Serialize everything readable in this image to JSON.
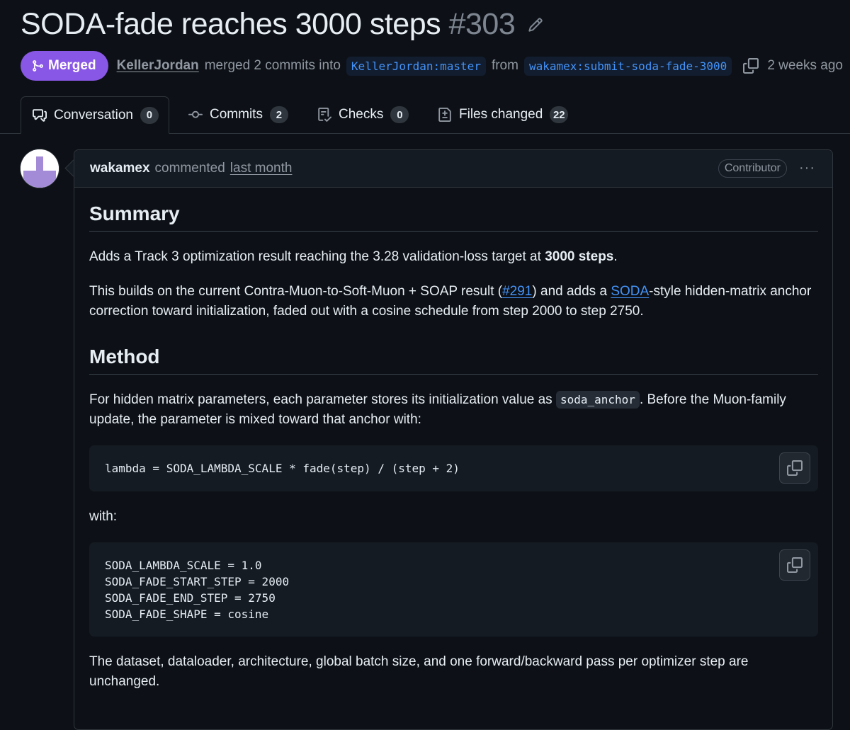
{
  "pr": {
    "title": "SODA-fade reaches 3000 steps",
    "number": "#303",
    "state": "Merged",
    "author": "KellerJordan",
    "merge_text": "merged 2 commits into",
    "base_branch": "KellerJordan:master",
    "from_text": "from",
    "head_branch": "wakamex:submit-soda-fade-3000",
    "time_ago": "2 weeks ago"
  },
  "tabs": [
    {
      "label": "Conversation",
      "count": "0",
      "icon": "comment-discussion-icon"
    },
    {
      "label": "Commits",
      "count": "2",
      "icon": "git-commit-icon"
    },
    {
      "label": "Checks",
      "count": "0",
      "icon": "checklist-icon"
    },
    {
      "label": "Files changed",
      "count": "22",
      "icon": "file-diff-icon"
    }
  ],
  "comment": {
    "user": "wakamex",
    "action": "commented",
    "time": "last month",
    "role": "Contributor",
    "menu": "···"
  },
  "content": {
    "summary_heading": "Summary",
    "p1_pre": "Adds a Track 3 optimization result reaching the 3.28 validation-loss target at ",
    "p1_bold": "3000 steps",
    "p1_post": ".",
    "p2_a": "This builds on the current Contra-Muon-to-Soft-Muon + SOAP result (",
    "p2_link1": "#291",
    "p2_b": ") and adds a ",
    "p2_link2": "SODA",
    "p2_c": "-style hidden-matrix anchor correction toward initialization, faded out with a cosine schedule from step 2000 to step 2750.",
    "method_heading": "Method",
    "p3_a": "For hidden matrix parameters, each parameter stores its initialization value as ",
    "p3_code": "soda_anchor",
    "p3_b": ". Before the Muon-family update, the parameter is mixed toward that anchor with:",
    "code1": "lambda = SODA_LAMBDA_SCALE * fade(step) / (step + 2)",
    "with_text": "with:",
    "code2": "SODA_LAMBDA_SCALE = 1.0\nSODA_FADE_START_STEP = 2000\nSODA_FADE_END_STEP = 2750\nSODA_FADE_SHAPE = cosine",
    "p4": "The dataset, dataloader, architecture, global batch size, and one forward/backward pass per optimizer step are unchanged."
  },
  "colors": {
    "background": "#0d1117",
    "merged": "#8957e5",
    "link": "#4493f8",
    "border": "#30363d"
  }
}
